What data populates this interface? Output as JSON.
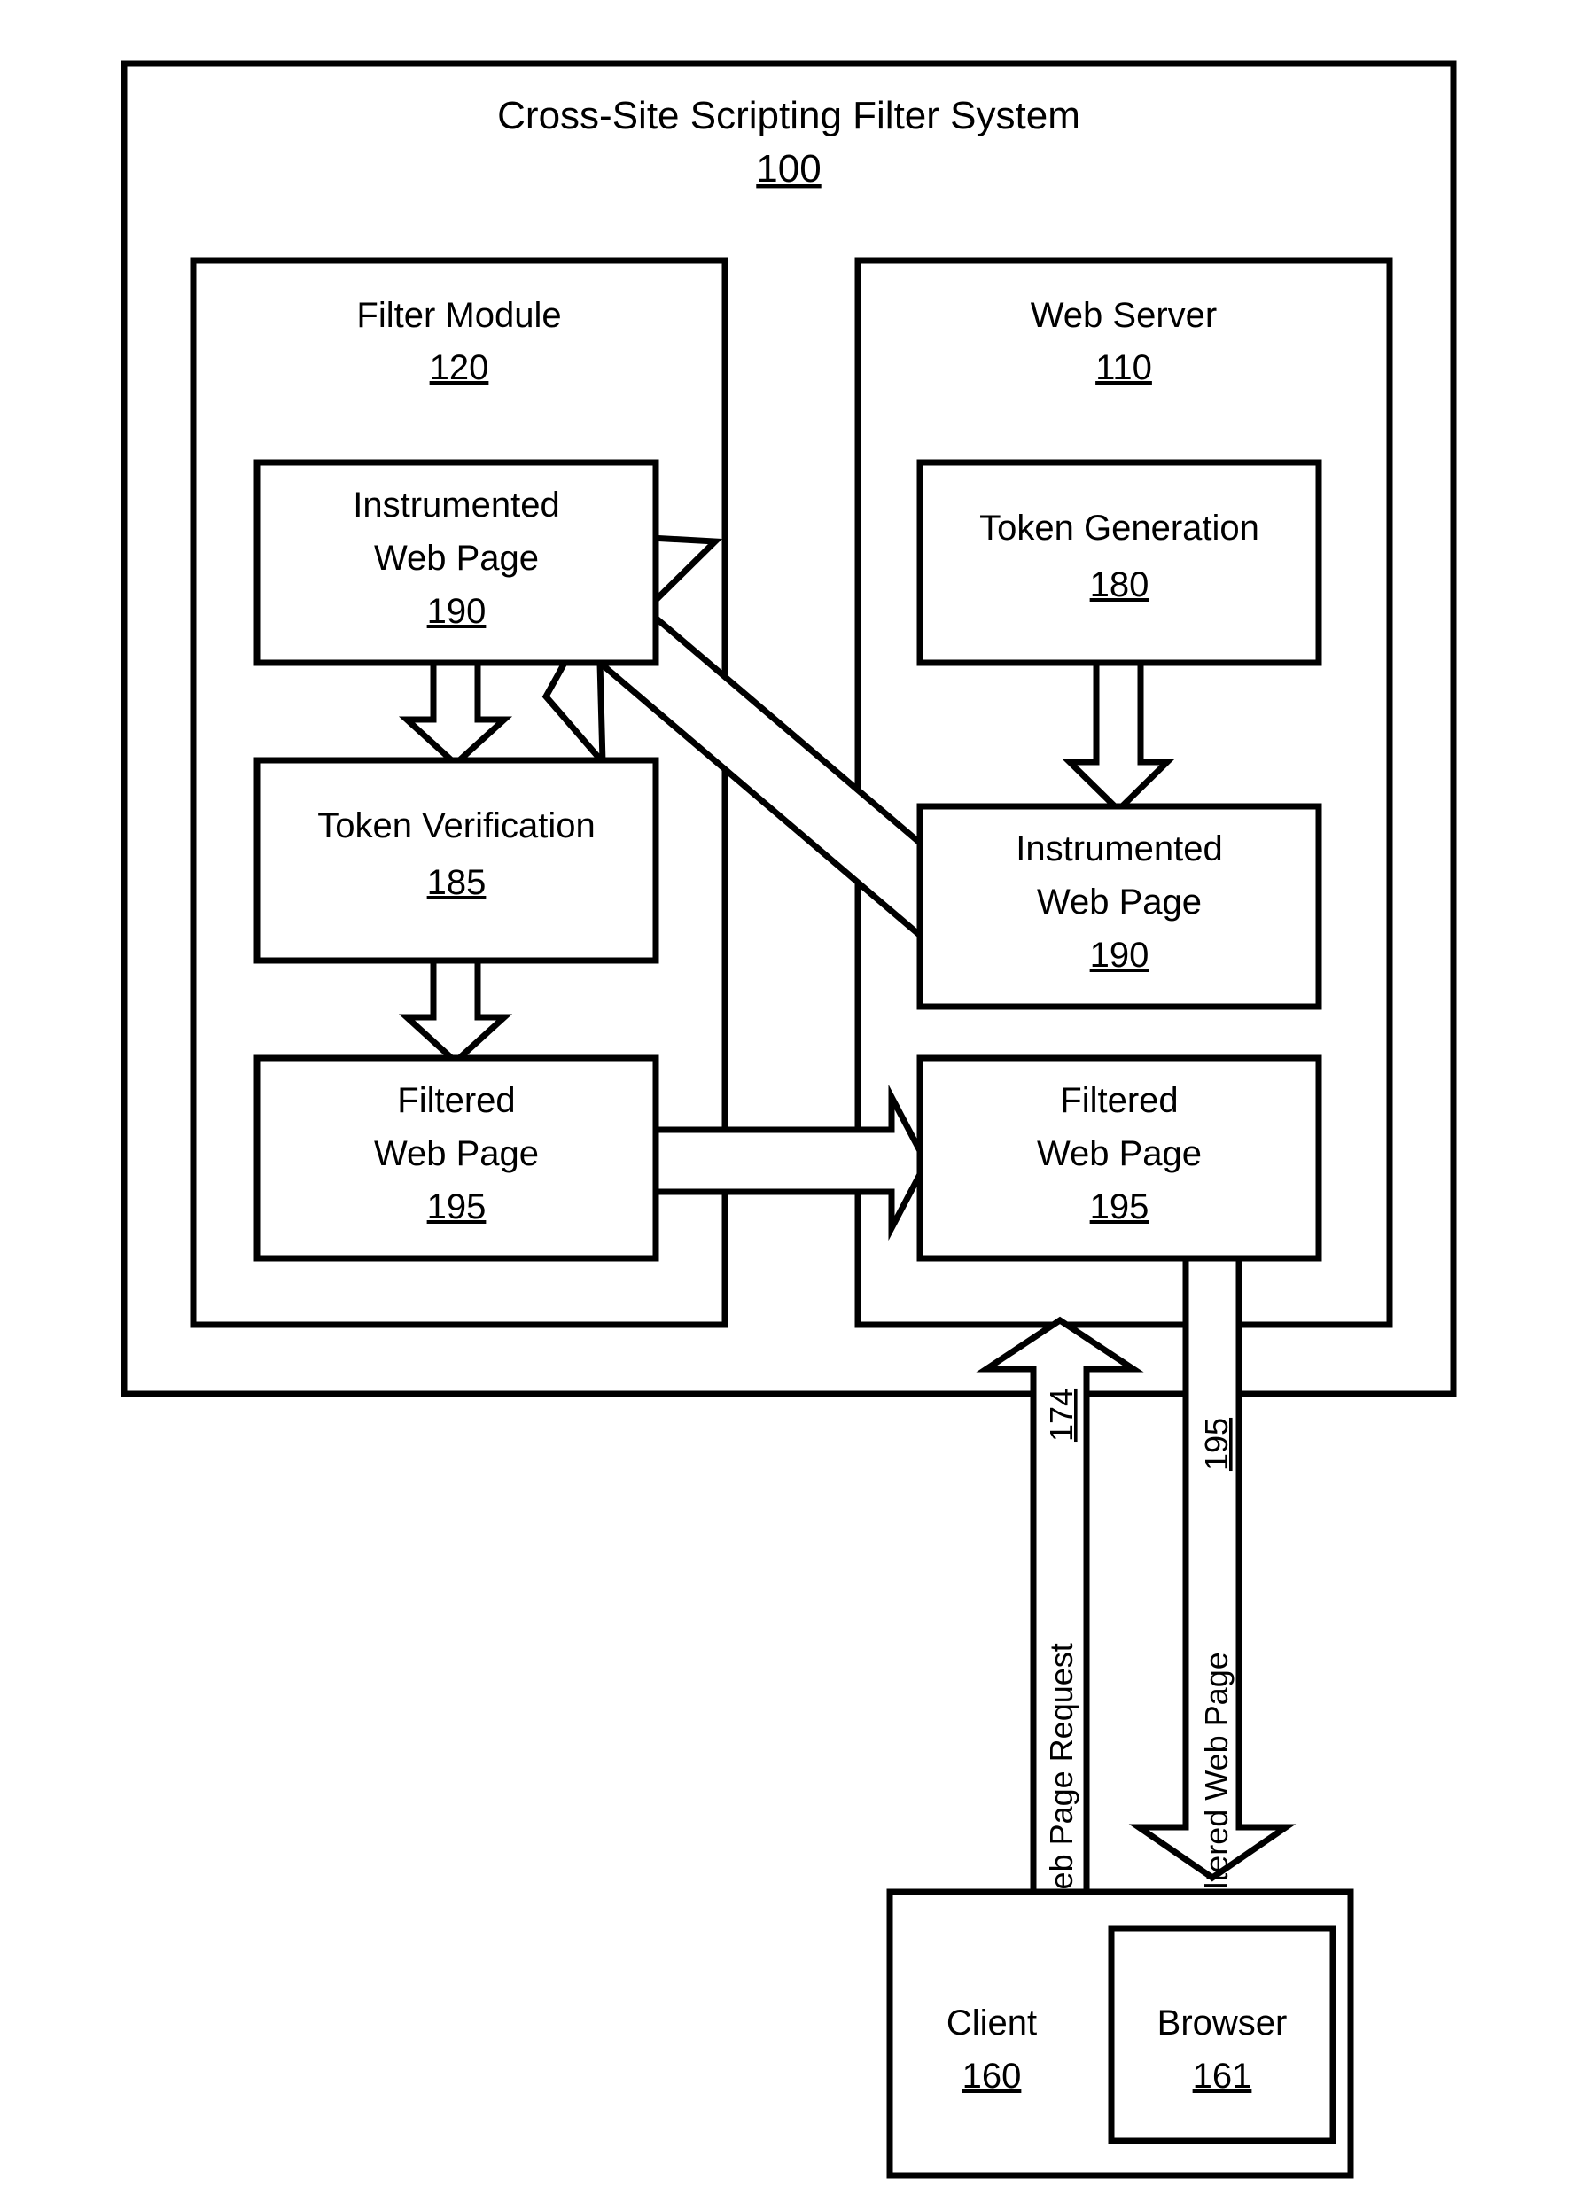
{
  "figure": {
    "title": "Cross-Site Scripting Filter System",
    "title_ref": "100"
  },
  "groups": {
    "filter_module": {
      "label": "Filter Module",
      "ref": "120"
    },
    "web_server": {
      "label": "Web Server",
      "ref": "110"
    }
  },
  "boxes": {
    "filter_instrumented": {
      "line1": "Instrumented",
      "line2": "Web Page",
      "ref": "190"
    },
    "token_verification": {
      "line1": "Token Verification",
      "line2": "",
      "ref": "185"
    },
    "filter_filtered": {
      "line1": "Filtered",
      "line2": "Web Page",
      "ref": "195"
    },
    "token_generation": {
      "line1": "Token Generation",
      "line2": "",
      "ref": "180"
    },
    "server_instrumented": {
      "line1": "Instrumented",
      "line2": "Web Page",
      "ref": "190"
    },
    "server_filtered": {
      "line1": "Filtered",
      "line2": "Web Page",
      "ref": "195"
    },
    "client": {
      "label": "Client",
      "ref": "160"
    },
    "browser": {
      "label": "Browser",
      "ref": "161"
    }
  },
  "connectors": {
    "web_page_request": {
      "label": "Web Page Request",
      "ref": "174"
    },
    "filtered_web_page_down": {
      "label": "Filtered Web Page",
      "ref": "195"
    }
  }
}
